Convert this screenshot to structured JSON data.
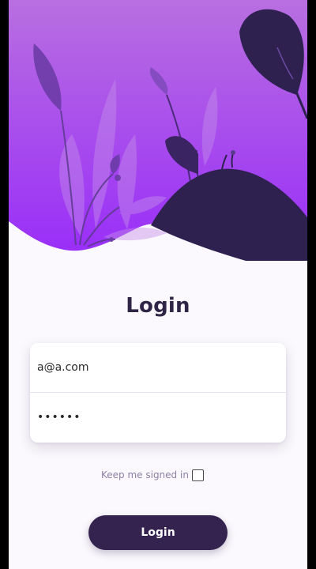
{
  "login": {
    "title": "Login",
    "email_value": "a@a.com",
    "password_value": "••••••",
    "keep_signed_in_label": "Keep me signed in",
    "keep_signed_in_checked": false,
    "submit_label": "Login"
  },
  "colors": {
    "gradient_top": "#b068e0",
    "gradient_bottom": "#9b33f7",
    "dark_purple": "#2e2150",
    "button": "#34234f",
    "title": "#2f2547"
  },
  "icons": {
    "hero": "leaves-and-hill-illustration",
    "checkbox": "checkbox-unchecked"
  }
}
